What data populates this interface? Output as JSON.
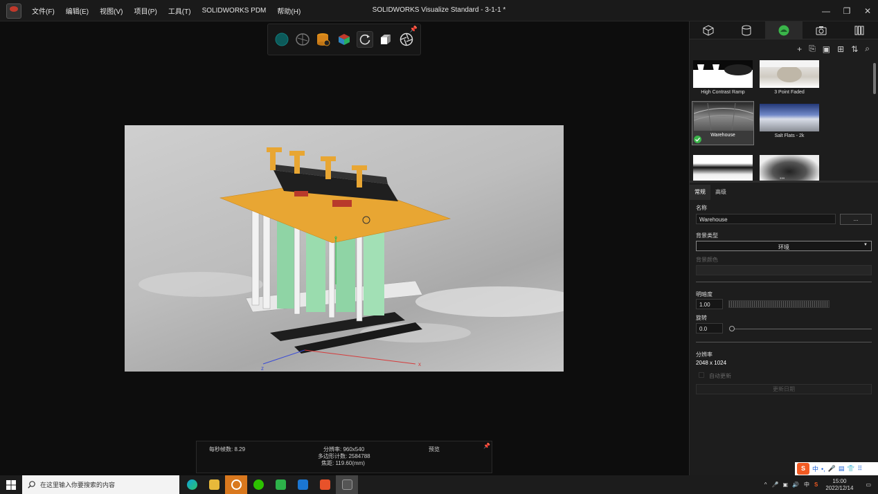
{
  "titlebar": {
    "title": "SOLIDWORKS Visualize Standard - 3-1-1 *",
    "menu": [
      "文件(F)",
      "编辑(E)",
      "视图(V)",
      "项目(P)",
      "工具(T)",
      "SOLIDWORKS PDM",
      "帮助(H)"
    ],
    "controls": [
      "—",
      "❐",
      "✕"
    ]
  },
  "viewport": {
    "toolbar_icons": [
      "sphere-icon",
      "neural-icon",
      "database-icon",
      "cube-color-icon",
      "rotate-icon",
      "box-icon",
      "aperture-icon"
    ],
    "pin_icon": "📌",
    "render": {
      "axis_z": "z",
      "axis_x": "x",
      "axis_y": "y"
    },
    "stats": {
      "fps": "每秒帧数:  8.29",
      "resolution": "分辨率:  960x540",
      "poly_count": "多边形计数:  2584788",
      "focal": "焦距:  119.60(mm)",
      "preview": "预览",
      "pin": "📌"
    }
  },
  "panel": {
    "tabs": [
      "model-icon",
      "appearance-icon",
      "environment-icon",
      "camera-icon",
      "library-icon"
    ],
    "tools": [
      "+",
      "⎘",
      "▣",
      "⊞",
      "⇅",
      "⌕"
    ],
    "thumbs": [
      {
        "label": "High Contrast Ramp"
      },
      {
        "label": "3 Point Faded"
      },
      {
        "label": "Warehouse"
      },
      {
        "label": "Salt Flats - 2k"
      },
      {
        "label": ""
      },
      {
        "label": ""
      }
    ],
    "more_dots": "•••",
    "subtabs": [
      "常规",
      "高级"
    ],
    "props": {
      "name_label": "名称",
      "name_value": "Warehouse",
      "name_btn": "...",
      "bg_type_label": "背景类型",
      "bg_type_value": "环境",
      "bg_color_label": "背景颜色",
      "brightness_label": "明暗度",
      "brightness_value": "1.00",
      "rotation_label": "旋转",
      "rotation_value": "0.0",
      "resolution_label": "分辨率",
      "resolution_value": "2048 x 1024",
      "auto_update": "自动更新",
      "update_btn": "更新日期"
    }
  },
  "taskbar": {
    "search_placeholder": "在这里输入你要搜索的内容",
    "time": "15:00",
    "date": "2022/12/14",
    "ime_label": "中",
    "tray_lang": "中"
  }
}
